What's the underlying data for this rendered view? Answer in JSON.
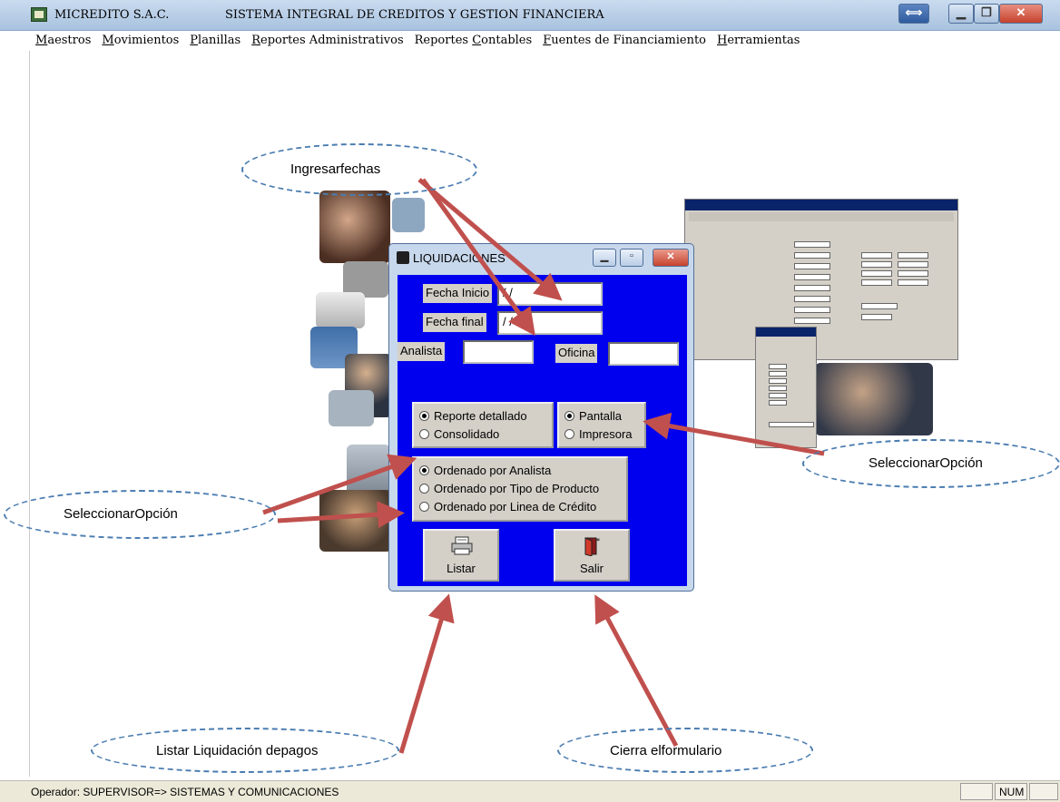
{
  "window": {
    "app_name": "MICREDITO S.A.C.",
    "title": "SISTEMA INTEGRAL DE CREDITOS Y GESTION FINANCIERA"
  },
  "menu": [
    {
      "pre": "",
      "u": "M",
      "post": "aestros"
    },
    {
      "pre": "",
      "u": "M",
      "post": "ovimientos"
    },
    {
      "pre": "",
      "u": "P",
      "post": "lanillas"
    },
    {
      "pre": "",
      "u": "R",
      "post": "eportes Administrativos"
    },
    {
      "pre": "Reportes ",
      "u": "C",
      "post": "ontables"
    },
    {
      "pre": "",
      "u": "F",
      "post": "uentes de Financiamiento"
    },
    {
      "pre": "",
      "u": "H",
      "post": "erramientas"
    }
  ],
  "dialog": {
    "title": "LIQUIDACIONES",
    "fecha_inicio_label": "Fecha Inicio",
    "fecha_inicio_value": "/ /",
    "fecha_final_label": "Fecha final",
    "fecha_final_value": "/ /",
    "analista_label": "Analista",
    "analista_value": "",
    "oficina_label": "Oficina",
    "oficina_value": "",
    "report_type": [
      {
        "label": "Reporte detallado",
        "selected": true
      },
      {
        "label": "Consolidado",
        "selected": false
      }
    ],
    "output": [
      {
        "label": "Pantalla",
        "selected": true
      },
      {
        "label": "Impresora",
        "selected": false
      }
    ],
    "order": [
      {
        "label": "Ordenado por Analista",
        "selected": true
      },
      {
        "label": "Ordenado por Tipo de Producto",
        "selected": false
      },
      {
        "label": "Ordenado por Linea de Crédito",
        "selected": false
      }
    ],
    "listar_label": "Listar",
    "salir_label": "Salir"
  },
  "annotations": {
    "ingresar_fechas": "Ingresarfechas",
    "seleccionar_opcion_right": "SeleccionarOpción",
    "seleccionar_opcion_left": "SeleccionarOpción",
    "listar": "Listar Liquidación depagos",
    "cierra": "Cierra elformulario"
  },
  "status": {
    "operator": "Operador: SUPERVISOR=> SISTEMAS Y COMUNICACIONES",
    "panel1": "",
    "panel2": "NUM",
    "panel3": ""
  },
  "colors": {
    "dialog_body": "#0000ee",
    "arrow": "#c0504d",
    "callout_border": "#4a7cb0"
  }
}
